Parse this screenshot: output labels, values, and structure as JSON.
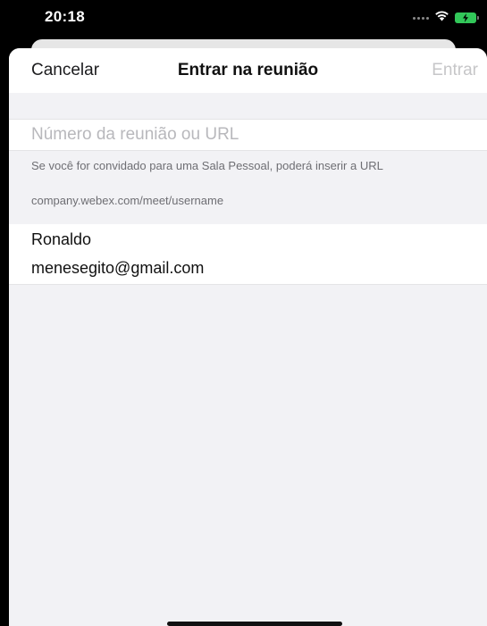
{
  "status_bar": {
    "time": "20:18",
    "icons": [
      "signal-dots-icon",
      "wifi-icon",
      "battery-charging-icon"
    ],
    "battery_color": "#32c759"
  },
  "nav": {
    "cancel_label": "Cancelar",
    "title": "Entrar na reunião",
    "join_label": "Entrar",
    "join_disabled_color": "#c6c6c8"
  },
  "meeting": {
    "url_placeholder": "Número da reunião ou URL",
    "url_value": "",
    "help_text": "Se você for convidado para uma Sala Pessoal, poderá inserir a URL",
    "example_url": "company.webex.com/meet/username"
  },
  "user": {
    "name": "Ronaldo",
    "email": "menesegito@gmail.com"
  }
}
